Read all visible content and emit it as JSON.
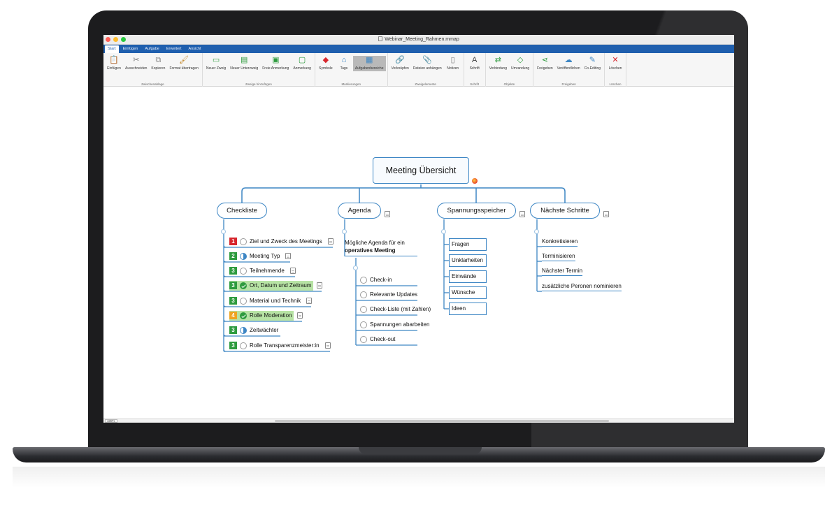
{
  "window": {
    "title": "Webinar_Meeting_Rahmen.mmap",
    "lights": [
      "#ff5f57",
      "#febc2e",
      "#28c840"
    ]
  },
  "tabs": [
    "Start",
    "Einfügen",
    "Aufgabe",
    "Erweitert",
    "Ansicht"
  ],
  "ribbon": {
    "groups": [
      {
        "label": "Zwischenablage",
        "buttons": [
          {
            "label": "Einfügen",
            "icon": "paste-icon"
          },
          {
            "label": "Ausschneiden",
            "icon": "scissors-icon"
          },
          {
            "label": "Kopieren",
            "icon": "copy-icon"
          },
          {
            "label": "Format übertragen",
            "icon": "format-painter-icon"
          }
        ]
      },
      {
        "label": "Zweige hinzufügen",
        "buttons": [
          {
            "label": "Neuer Zweig",
            "icon": "new-branch-icon"
          },
          {
            "label": "Neuer Unterzweig",
            "icon": "new-subbranch-icon"
          },
          {
            "label": "Freie Anmerkung",
            "icon": "free-note-icon"
          },
          {
            "label": "Anmerkung",
            "icon": "callout-icon"
          }
        ]
      },
      {
        "label": "Markierungen",
        "buttons": [
          {
            "label": "Symbole",
            "icon": "symbols-icon"
          },
          {
            "label": "Tags",
            "icon": "tag-icon"
          },
          {
            "label": "Aufgabenbereiche",
            "icon": "task-pane-icon"
          }
        ]
      },
      {
        "label": "Zweigelemente",
        "buttons": [
          {
            "label": "Verknüpfen",
            "icon": "link-icon"
          },
          {
            "label": "Dateien anhängen",
            "icon": "paperclip-icon"
          },
          {
            "label": "Notizen",
            "icon": "notes-icon"
          }
        ]
      },
      {
        "label": "Schrift",
        "buttons": [
          {
            "label": "Schrift",
            "icon": "font-icon"
          }
        ]
      },
      {
        "label": "Objekte",
        "buttons": [
          {
            "label": "Verbindung",
            "icon": "relationship-icon"
          },
          {
            "label": "Umrandung",
            "icon": "boundary-icon"
          }
        ]
      },
      {
        "label": "Freigeben",
        "buttons": [
          {
            "label": "Freigeben",
            "icon": "share-icon"
          },
          {
            "label": "Veröffentlichen",
            "icon": "cloud-icon"
          },
          {
            "label": "Co-Editing",
            "icon": "co-editing-icon"
          }
        ]
      },
      {
        "label": "Löschen",
        "buttons": [
          {
            "label": "Löschen",
            "icon": "delete-x-icon"
          }
        ]
      }
    ]
  },
  "map": {
    "central": "Meeting Übersicht",
    "branches": {
      "checkliste": {
        "label": "Checkliste",
        "tasks": [
          {
            "prio": "1",
            "prio_color": "#d7262d",
            "progress": "empty",
            "text": "Ziel und Zweck des Meetings",
            "note": true,
            "highlight": false
          },
          {
            "prio": "2",
            "prio_color": "#2e9b3e",
            "progress": "half",
            "text": "Meeting Typ",
            "note": true,
            "highlight": false
          },
          {
            "prio": "3",
            "prio_color": "#2e9b3e",
            "progress": "empty",
            "text": "Teilnehmende",
            "note": true,
            "highlight": false
          },
          {
            "prio": "3",
            "prio_color": "#2e9b3e",
            "progress": "done",
            "text": "Ort, Datum und Zeitraum",
            "note": true,
            "highlight": true
          },
          {
            "prio": "3",
            "prio_color": "#2e9b3e",
            "progress": "empty",
            "text": "Material und Technik",
            "note": true,
            "highlight": false
          },
          {
            "prio": "4",
            "prio_color": "#f0a322",
            "progress": "done",
            "text": "Rolle Moderation",
            "note": true,
            "highlight": true
          },
          {
            "prio": "3",
            "prio_color": "#2e9b3e",
            "progress": "half",
            "text": "Zeitwächter",
            "note": false,
            "highlight": false
          },
          {
            "prio": "3",
            "prio_color": "#2e9b3e",
            "progress": "empty",
            "text": "Rolle Transparenzmeister:in",
            "note": true,
            "highlight": false
          }
        ]
      },
      "agenda": {
        "label": "Agenda",
        "intro_line1": "Mögliche Agenda für ein",
        "intro_line2": "operatives Meeting",
        "items": [
          "Check-in",
          "Relevante Updates",
          "Check-Liste (mit Zahlen)",
          "Spannungen abarbeiten",
          "Check-out"
        ]
      },
      "spannungsspeicher": {
        "label": "Spannungsspeicher",
        "items": [
          "Fragen",
          "Unklarheiten",
          "Einwände",
          "Wünsche",
          "Ideen"
        ]
      },
      "naechste": {
        "label": "Nächste Schritte",
        "items": [
          "Konkretisieren",
          "Terminisieren",
          "Nächster Termin",
          "zusätzliche Peronen nominieren"
        ]
      }
    }
  },
  "status": {
    "zoom": "100%"
  },
  "colors": {
    "branch_line": "#3d86c4",
    "ribbon_tab": "#1f5fae"
  }
}
